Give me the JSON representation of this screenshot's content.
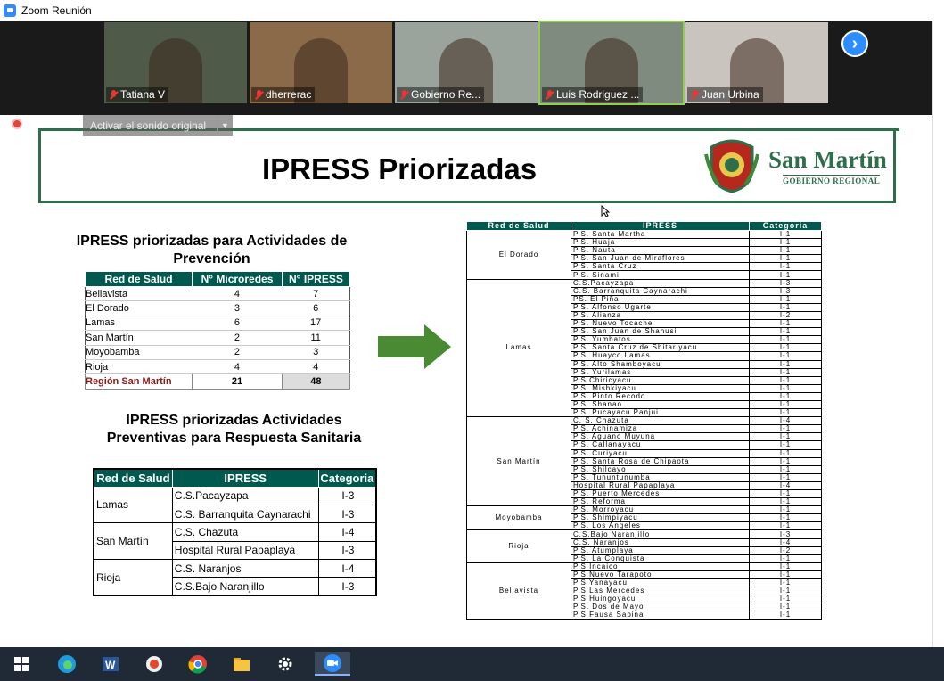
{
  "window": {
    "title": "Zoom Reunión"
  },
  "participants": [
    {
      "name": "Tatiana V",
      "bg": "#4f5a48",
      "active": false
    },
    {
      "name": "dherrerac",
      "bg": "#8a6a48",
      "active": false
    },
    {
      "name": "Gobierno Re...",
      "bg": "#9aa49c",
      "active": false
    },
    {
      "name": "Luis Rodriguez ...",
      "bg": "#7f8b7f",
      "active": true
    },
    {
      "name": "Juan Urbina",
      "bg": "#c9c4bd",
      "active": false
    }
  ],
  "controls": {
    "audio_original": "Activar el sonido original"
  },
  "slide": {
    "title": "IPRESS Priorizadas",
    "brand": "San Martín",
    "brand_sub": "GOBIERNO REGIONAL",
    "section1_title_l1": "IPRESS priorizadas para Actividades de",
    "section1_title_l2": "Prevención",
    "section2_title_l1": "IPRESS priorizadas Actividades",
    "section2_title_l2": "Preventivas para Respuesta Sanitaria",
    "table1": {
      "headers": [
        "Red de Salud",
        "N° Microredes",
        "N° IPRESS"
      ],
      "rows": [
        [
          "Bellavista",
          "4",
          "7"
        ],
        [
          "El Dorado",
          "3",
          "6"
        ],
        [
          "Lamas",
          "6",
          "17"
        ],
        [
          "San Martín",
          "2",
          "11"
        ],
        [
          "Moyobamba",
          "2",
          "3"
        ],
        [
          "Rioja",
          "4",
          "4"
        ]
      ],
      "total": [
        "Región San Martín",
        "21",
        "48"
      ]
    },
    "table2": {
      "headers": [
        "Red de Salud",
        "IPRESS",
        "Categoria"
      ],
      "groups": [
        {
          "red": "Lamas",
          "items": [
            [
              "C.S.Pacayzapa",
              "I-3"
            ],
            [
              "C.S. Barranquita Caynarachi",
              "I-3"
            ]
          ]
        },
        {
          "red": "San Martín",
          "items": [
            [
              "C.S. Chazuta",
              "I-4"
            ],
            [
              "Hospital Rural Papaplaya",
              "I-3"
            ]
          ]
        },
        {
          "red": "Rioja",
          "items": [
            [
              "C.S. Naranjos",
              "I-4"
            ],
            [
              "C.S.Bajo Naranjillo",
              "I-3"
            ]
          ]
        }
      ]
    },
    "table3": {
      "headers": [
        "Red de Salud",
        "IPRESS",
        "Categoria"
      ],
      "groups": [
        {
          "red": "El Dorado",
          "items": [
            [
              "P.S. Santa Martha",
              "I-1"
            ],
            [
              "P.S. Huaja",
              "I-1"
            ],
            [
              "P.S. Nauta",
              "I-1"
            ],
            [
              "P.S. San Juan de Miraflores",
              "I-1"
            ],
            [
              "P.S. Santa Cruz",
              "I-1"
            ],
            [
              "P.S. Sinami",
              "I-1"
            ]
          ]
        },
        {
          "red": "Lamas",
          "items": [
            [
              "C.S.Pacayzapa",
              "I-3"
            ],
            [
              "C.S. Barranquita Caynarachi",
              "I-3"
            ],
            [
              "PS. El Piñal",
              "I-1"
            ],
            [
              "P.S. Alfonso Ugarte",
              "I-1"
            ],
            [
              "P.S. Alianza",
              "I-2"
            ],
            [
              "P.S. Nuevo Tocache",
              "I-1"
            ],
            [
              "P.S. San Juan de Shanusi",
              "I-1"
            ],
            [
              "P.S. Yumbatos",
              "I-1"
            ],
            [
              "P.S. Santa Cruz de Shitariyacu",
              "I-1"
            ],
            [
              "P.S. Huayco Lamas",
              "I-1"
            ],
            [
              "P.S. Alto Shamboyacu",
              "I-1"
            ],
            [
              "P.S. Yurilamas",
              "I-1"
            ],
            [
              "P.S.Chiricyacu",
              "I-1"
            ],
            [
              "P.S. Mishkiyacu",
              "I-1"
            ],
            [
              "P.S. Pinto Recodo",
              "I-1"
            ],
            [
              "P.S. Shanao",
              "I-1"
            ],
            [
              "P.S. Pucayacu Panjui",
              "I-1"
            ]
          ]
        },
        {
          "red": "San Martín",
          "items": [
            [
              "C. S. Chazuta",
              "I-4"
            ],
            [
              "P.S. Achinamiza",
              "I-1"
            ],
            [
              "P.S. Aguano Muyuna",
              "I-1"
            ],
            [
              "P.S. Callanayacu",
              "I-1"
            ],
            [
              "P.S. Curiyacu",
              "I-1"
            ],
            [
              "P.S. Santa Rosa de Chipaota",
              "I-1"
            ],
            [
              "P.S. Shilcayo",
              "I-1"
            ],
            [
              "P.S. Tununtunumba",
              "I-1"
            ],
            [
              "Hospital Rural Papaplaya",
              "I-4"
            ],
            [
              "P.S. Puerto Mercedes",
              "I-1"
            ],
            [
              "P.S. Reforma",
              "I-1"
            ]
          ]
        },
        {
          "red": "Moyobamba",
          "items": [
            [
              "P.S. Morroyacu",
              "I-1"
            ],
            [
              "P.S. Shimpiyacu",
              "I-1"
            ],
            [
              "P.S. Los Angeles",
              "I-1"
            ]
          ]
        },
        {
          "red": "Rioja",
          "items": [
            [
              "C.S.Bajo Naranjillo",
              "I-3"
            ],
            [
              "C.S. Naranjos",
              "I-4"
            ],
            [
              "P.S. Atumplaya",
              "I-2"
            ],
            [
              "P.S. La Conquista",
              "I-1"
            ]
          ]
        },
        {
          "red": "Bellavista",
          "items": [
            [
              "P.S Incaico",
              "I-1"
            ],
            [
              "P.S Nuevo Tarapoto",
              "I-1"
            ],
            [
              "P.S Yanayacu",
              "I-1"
            ],
            [
              "P.S Las Mercedes",
              "I-1"
            ],
            [
              "P.S Huingoyacu",
              "I-1"
            ],
            [
              "P.S. Dos de Mayo",
              "I-1"
            ],
            [
              "P.S Fausa Sapina",
              "I-1"
            ]
          ]
        }
      ]
    }
  },
  "taskbar": [
    {
      "name": "start-icon",
      "active": false
    },
    {
      "name": "edge-icon",
      "active": false
    },
    {
      "name": "word-icon",
      "active": false
    },
    {
      "name": "media-player-icon",
      "active": false
    },
    {
      "name": "chrome-icon",
      "active": false
    },
    {
      "name": "file-explorer-icon",
      "active": false
    },
    {
      "name": "settings-gear-icon",
      "active": false
    },
    {
      "name": "zoom-icon",
      "active": true
    }
  ]
}
